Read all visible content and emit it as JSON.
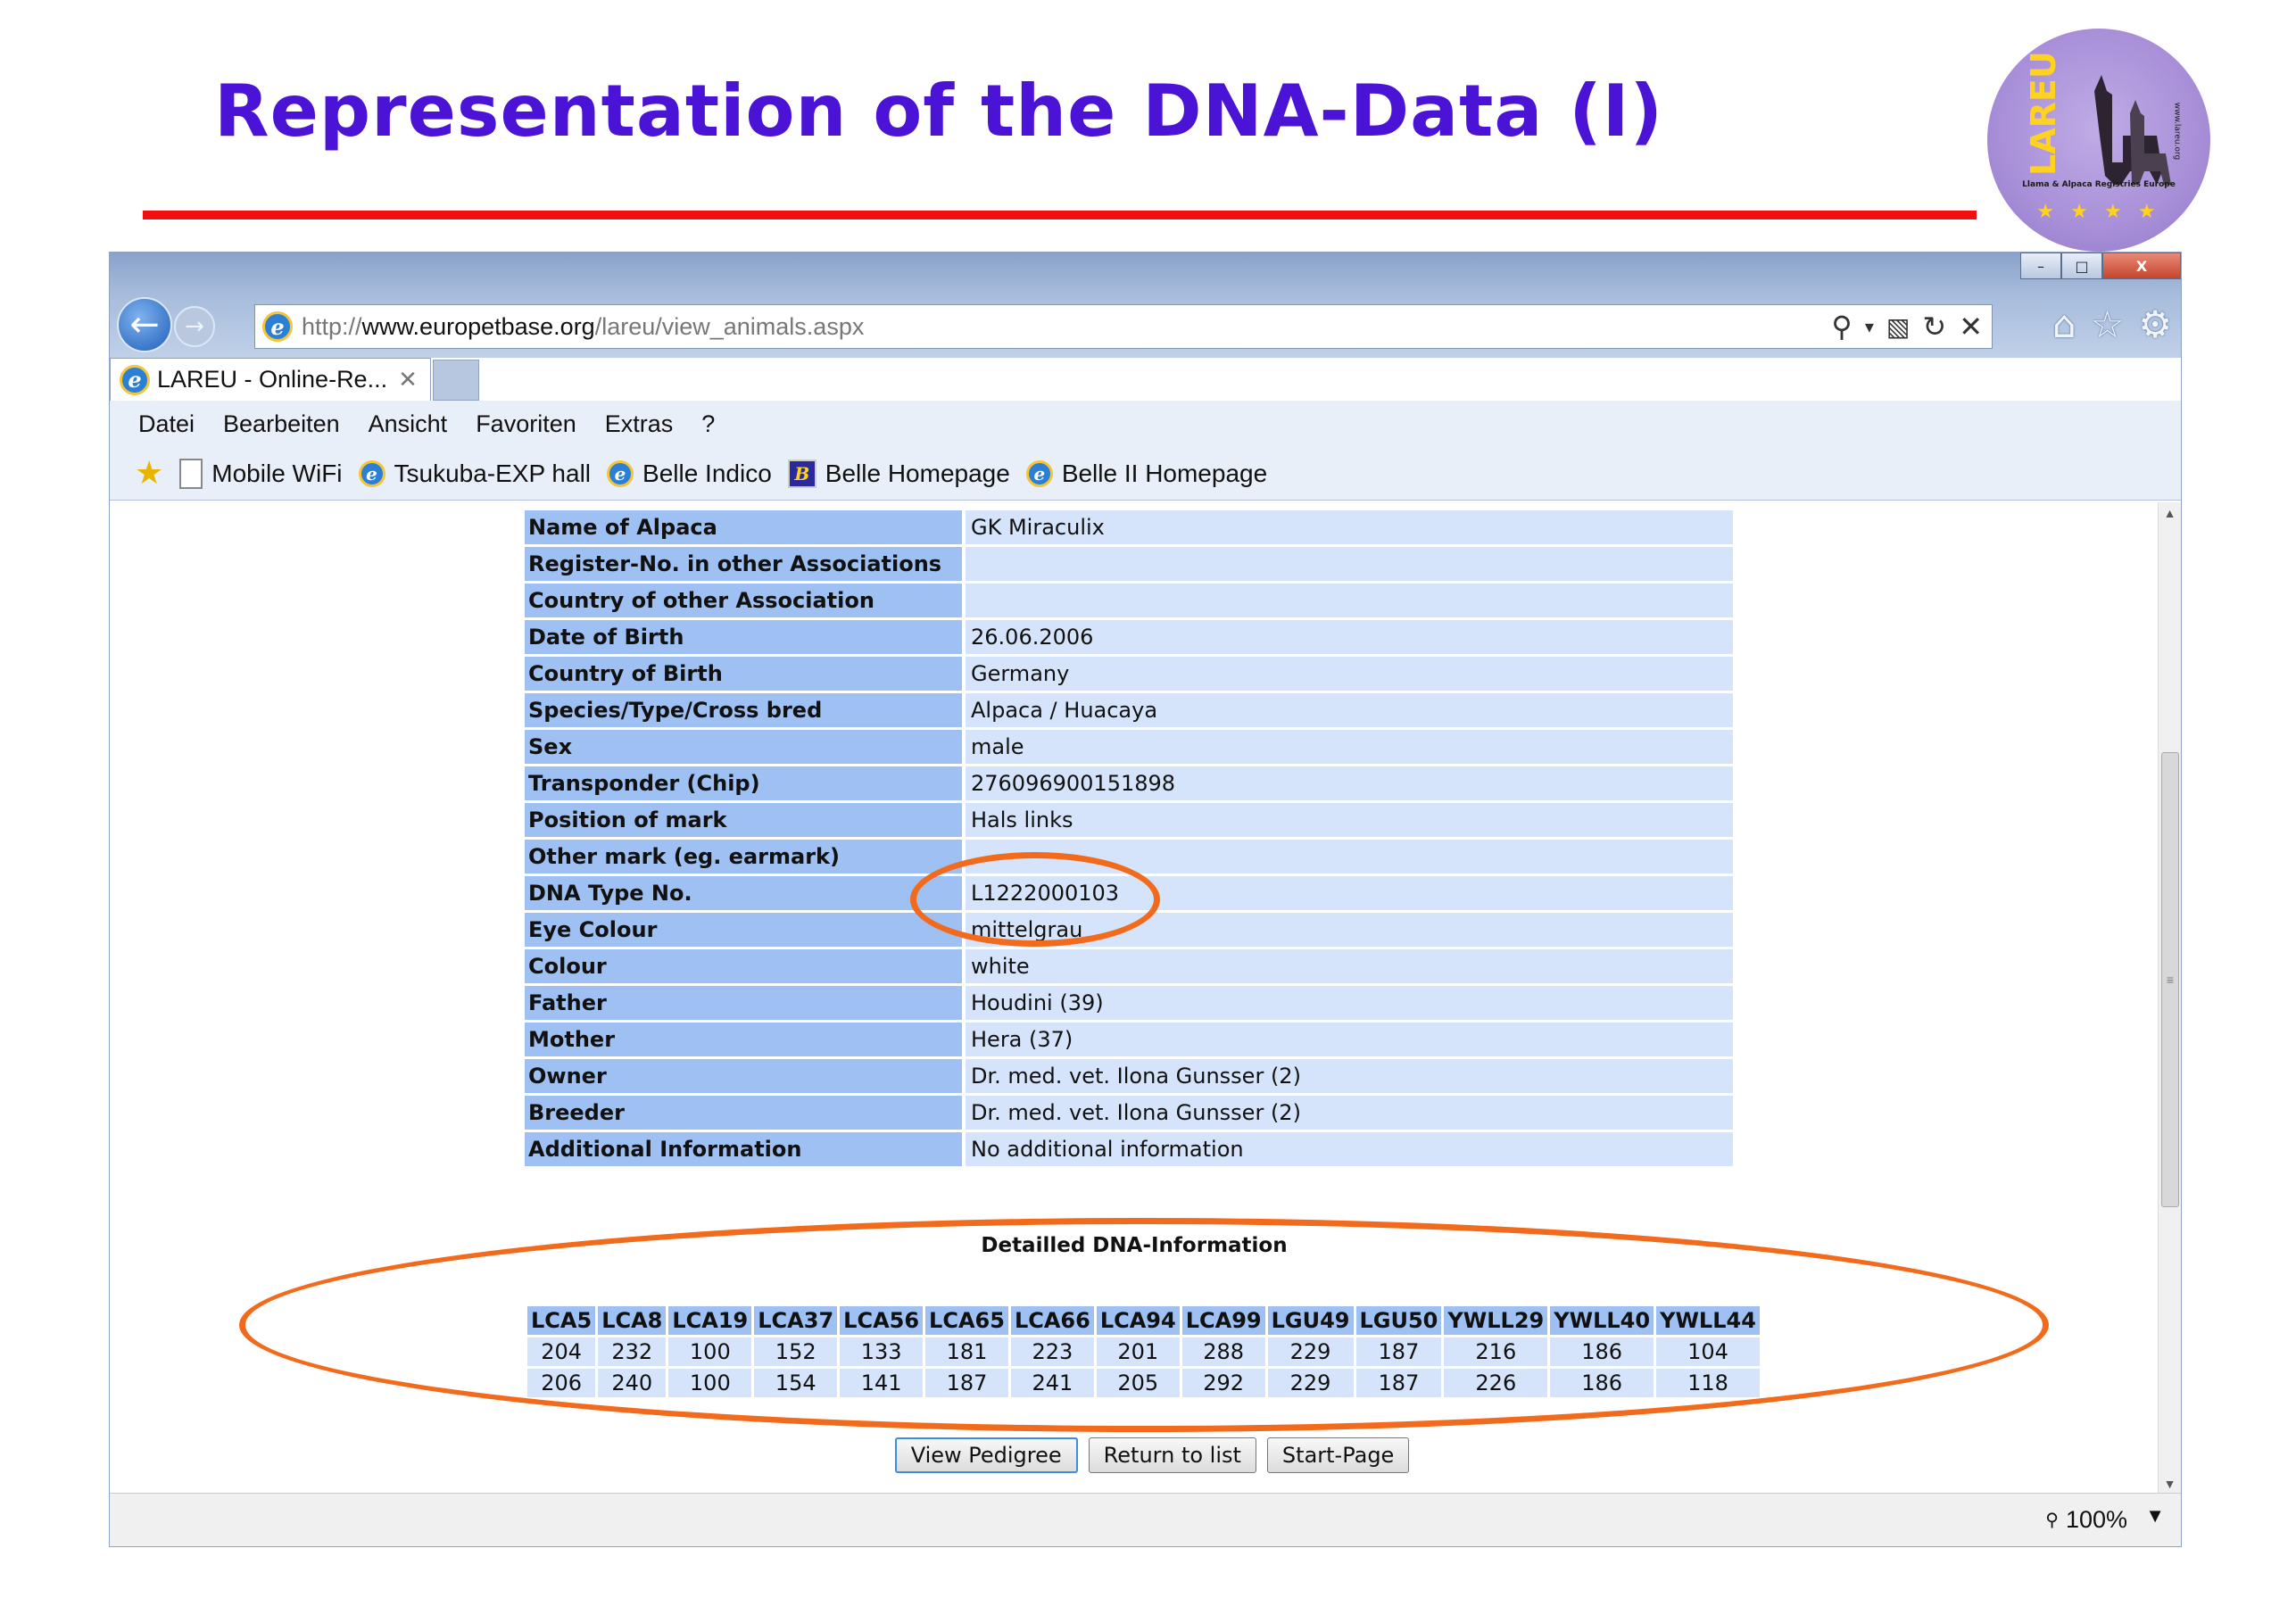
{
  "slide": {
    "title": "Representation of the DNA-Data (I)",
    "title_color": "#4a13d6",
    "rule_color": "#f01010",
    "logo": {
      "name": "LAREU",
      "subtitle": "Llama & Alpaca Registries Europe",
      "url": "www.lareu.org"
    }
  },
  "browser": {
    "window_controls": [
      "–",
      "□",
      "X"
    ],
    "address_url_prefix": "http://",
    "address_url_host": "www.europetbase.org",
    "address_url_path": "/lareu/view_animals.aspx",
    "tab_label": "LAREU - Online-Re...",
    "menu": [
      "Datei",
      "Bearbeiten",
      "Ansicht",
      "Favoriten",
      "Extras",
      "?"
    ],
    "favorites": [
      {
        "label": "Mobile WiFi",
        "icon": "page-icon"
      },
      {
        "label": "Tsukuba-EXP hall",
        "icon": "ie-icon"
      },
      {
        "label": "Belle Indico",
        "icon": "ie-icon"
      },
      {
        "label": "Belle Homepage",
        "icon": "belle-icon"
      },
      {
        "label": "Belle II Homepage",
        "icon": "ie-icon"
      }
    ],
    "zoom": "100%"
  },
  "animal": {
    "rows": [
      {
        "label": "Name of Alpaca",
        "value": "GK Miraculix"
      },
      {
        "label": "Register-No. in other Associations",
        "value": ""
      },
      {
        "label": "Country of other Association",
        "value": ""
      },
      {
        "label": "Date of Birth",
        "value": "26.06.2006"
      },
      {
        "label": "Country of Birth",
        "value": "Germany"
      },
      {
        "label": "Species/Type/Cross bred",
        "value": "Alpaca / Huacaya"
      },
      {
        "label": "Sex",
        "value": "male"
      },
      {
        "label": "Transponder (Chip)",
        "value": "276096900151898"
      },
      {
        "label": "Position of mark",
        "value": "Hals links"
      },
      {
        "label": "Other mark (eg. earmark)",
        "value": ""
      },
      {
        "label": "DNA Type No.",
        "value": "L1222000103"
      },
      {
        "label": "Eye Colour",
        "value": "mittelgrau"
      },
      {
        "label": "Colour",
        "value": "white"
      },
      {
        "label": "Father",
        "value": "Houdini (39)"
      },
      {
        "label": "Mother",
        "value": "Hera (37)"
      },
      {
        "label": "Owner",
        "value": "Dr. med. vet. Ilona Gunsser (2)"
      },
      {
        "label": "Breeder",
        "value": "Dr. med. vet. Ilona Gunsser (2)"
      },
      {
        "label": "Additional Information",
        "value": "No additional information"
      }
    ]
  },
  "dna": {
    "heading": "Detailled DNA-Information",
    "markers": [
      "LCA5",
      "LCA8",
      "LCA19",
      "LCA37",
      "LCA56",
      "LCA65",
      "LCA66",
      "LCA94",
      "LCA99",
      "LGU49",
      "LGU50",
      "YWLL29",
      "YWLL40",
      "YWLL44"
    ],
    "allele_rows": [
      [
        "204",
        "232",
        "100",
        "152",
        "133",
        "181",
        "223",
        "201",
        "288",
        "229",
        "187",
        "216",
        "186",
        "104"
      ],
      [
        "206",
        "240",
        "100",
        "154",
        "141",
        "187",
        "241",
        "205",
        "292",
        "229",
        "187",
        "226",
        "186",
        "118"
      ]
    ]
  },
  "buttons": {
    "view_pedigree": "View Pedigree",
    "return_to_list": "Return to list",
    "start_page": "Start-Page"
  },
  "colors": {
    "label_cell": "#9fc0f2",
    "value_cell": "#d5e4fa",
    "annotation": "#f26a1b"
  }
}
